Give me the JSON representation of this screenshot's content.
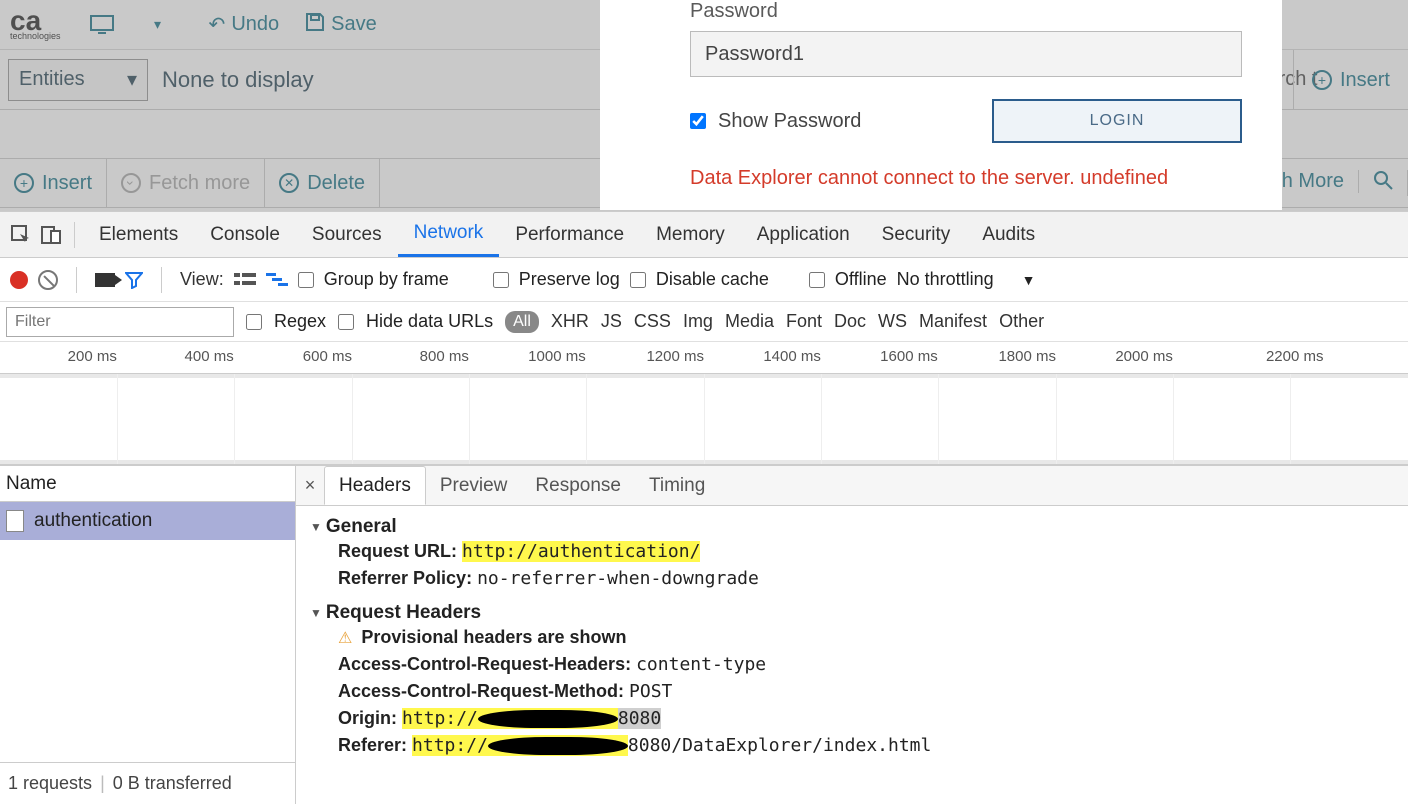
{
  "app": {
    "logo_text": "ca",
    "logo_sub": "technologies",
    "undo": "Undo",
    "save": "Save",
    "entities_label": "Entities",
    "none_display": "None to display",
    "search_placeholder": "Search t",
    "insert_right": "Insert",
    "fetch_more_right": "tch More",
    "tb3_insert": "Insert",
    "tb3_fetch": "Fetch more",
    "tb3_delete": "Delete"
  },
  "login": {
    "pw_label": "Password",
    "pw_value": "Password1",
    "show_pw": "Show Password",
    "login_btn": "LOGIN",
    "error": "Data Explorer cannot connect to the server. undefined"
  },
  "devtools": {
    "tabs": {
      "elements": "Elements",
      "console": "Console",
      "sources": "Sources",
      "network": "Network",
      "performance": "Performance",
      "memory": "Memory",
      "application": "Application",
      "security": "Security",
      "audits": "Audits"
    },
    "filter": {
      "view": "View:",
      "group_by_frame": "Group by frame",
      "preserve_log": "Preserve log",
      "disable_cache": "Disable cache",
      "offline": "Offline",
      "no_throttling": "No throttling",
      "filter_placeholder": "Filter",
      "regex": "Regex",
      "hide_data_urls": "Hide data URLs",
      "types": {
        "all": "All",
        "xhr": "XHR",
        "js": "JS",
        "css": "CSS",
        "img": "Img",
        "media": "Media",
        "font": "Font",
        "doc": "Doc",
        "ws": "WS",
        "manifest": "Manifest",
        "other": "Other"
      }
    },
    "timeline": [
      "200 ms",
      "400 ms",
      "600 ms",
      "800 ms",
      "1000 ms",
      "1200 ms",
      "1400 ms",
      "1600 ms",
      "1800 ms",
      "2000 ms",
      "2200 ms"
    ],
    "reqlist": {
      "name_hdr": "Name",
      "row1": "authentication",
      "footer_requests": "1 requests",
      "footer_transferred": "0 B transferred"
    },
    "detail": {
      "tabs": {
        "headers": "Headers",
        "preview": "Preview",
        "response": "Response",
        "timing": "Timing"
      },
      "general": "General",
      "request_url_k": "Request URL:",
      "request_url_v": "http://authentication/",
      "referrer_policy_k": "Referrer Policy:",
      "referrer_policy_v": "no-referrer-when-downgrade",
      "request_headers": "Request Headers",
      "provisional": "Provisional headers are shown",
      "ac_req_headers_k": "Access-Control-Request-Headers:",
      "ac_req_headers_v": "content-type",
      "ac_req_method_k": "Access-Control-Request-Method:",
      "ac_req_method_v": "POST",
      "origin_k": "Origin:",
      "origin_v_prefix": "http://",
      "origin_v_suffix": "8080",
      "referer_k": "Referer:",
      "referer_v_prefix": "http://",
      "referer_v_suffix": "8080/DataExplorer/index.html"
    }
  }
}
